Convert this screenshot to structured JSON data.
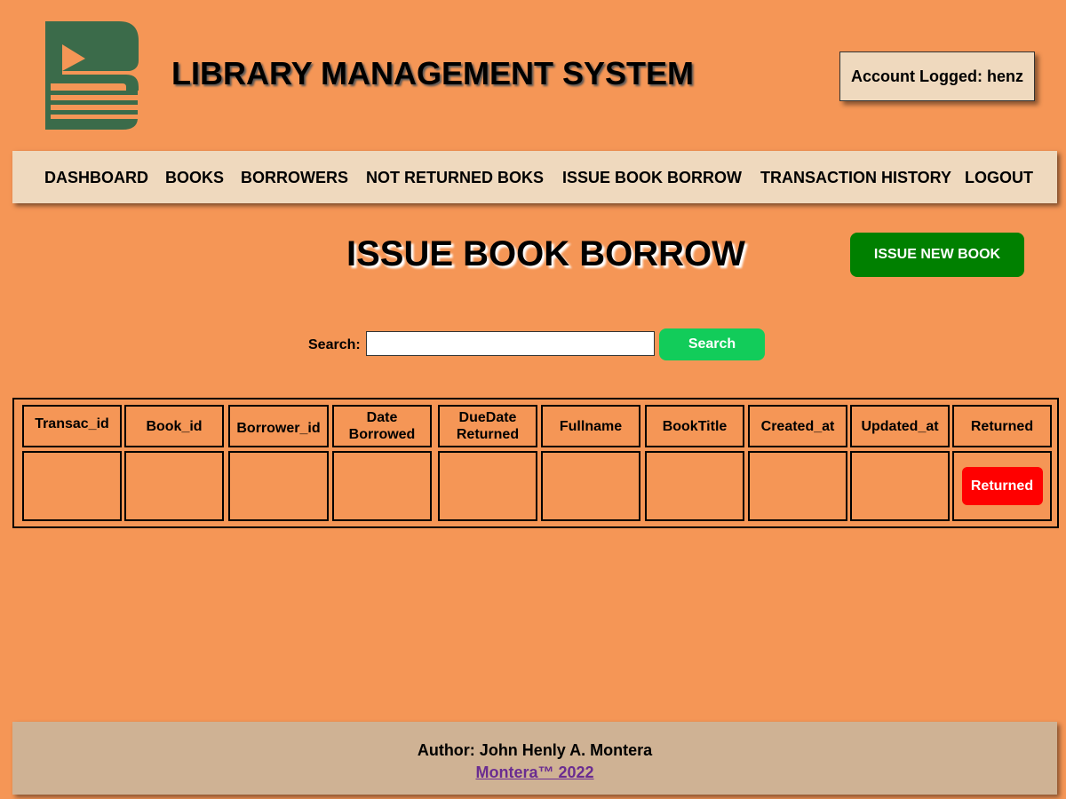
{
  "header": {
    "logo_icon": "library-logo-icon",
    "title": "LIBRARY MANAGEMENT SYSTEM",
    "account_label": "Account Logged: henz"
  },
  "nav": {
    "items": [
      {
        "label": "DASHBOARD"
      },
      {
        "label": "BOOKS"
      },
      {
        "label": "BORROWERS"
      },
      {
        "label": "NOT RETURNED BOKS"
      },
      {
        "label": "ISSUE BOOK BORROW"
      },
      {
        "label": "TRANSACTION HISTORY"
      },
      {
        "label": "LOGOUT"
      }
    ]
  },
  "main": {
    "heading": "ISSUE BOOK BORROW",
    "issue_button": "ISSUE NEW BOOK",
    "search": {
      "label": "Search:",
      "value": "",
      "placeholder": "",
      "button": "Search"
    }
  },
  "table": {
    "columns": [
      "Transac_id",
      "Book_id",
      "Borrower_id",
      "Date Borrowed",
      "DueDate Returned",
      "Fullname",
      "BookTitle",
      "Created_at",
      "Updated_at",
      "Returned"
    ],
    "rows": [
      {
        "cells": [
          "",
          "",
          "",
          "",
          "",
          "",
          "",
          "",
          ""
        ],
        "action": "Returned"
      }
    ]
  },
  "footer": {
    "author": "Author: John Henly A. Montera",
    "link": "Montera™ 2022"
  },
  "colors": {
    "page_bg": "#f59656",
    "panel_bg": "#efd9be",
    "footer_bg": "#cfb294",
    "logo_green": "#3b6b4a",
    "issue_button": "#008000",
    "search_button": "#12cc5a",
    "returned_button": "#ff0000",
    "link": "#6a2c91"
  }
}
